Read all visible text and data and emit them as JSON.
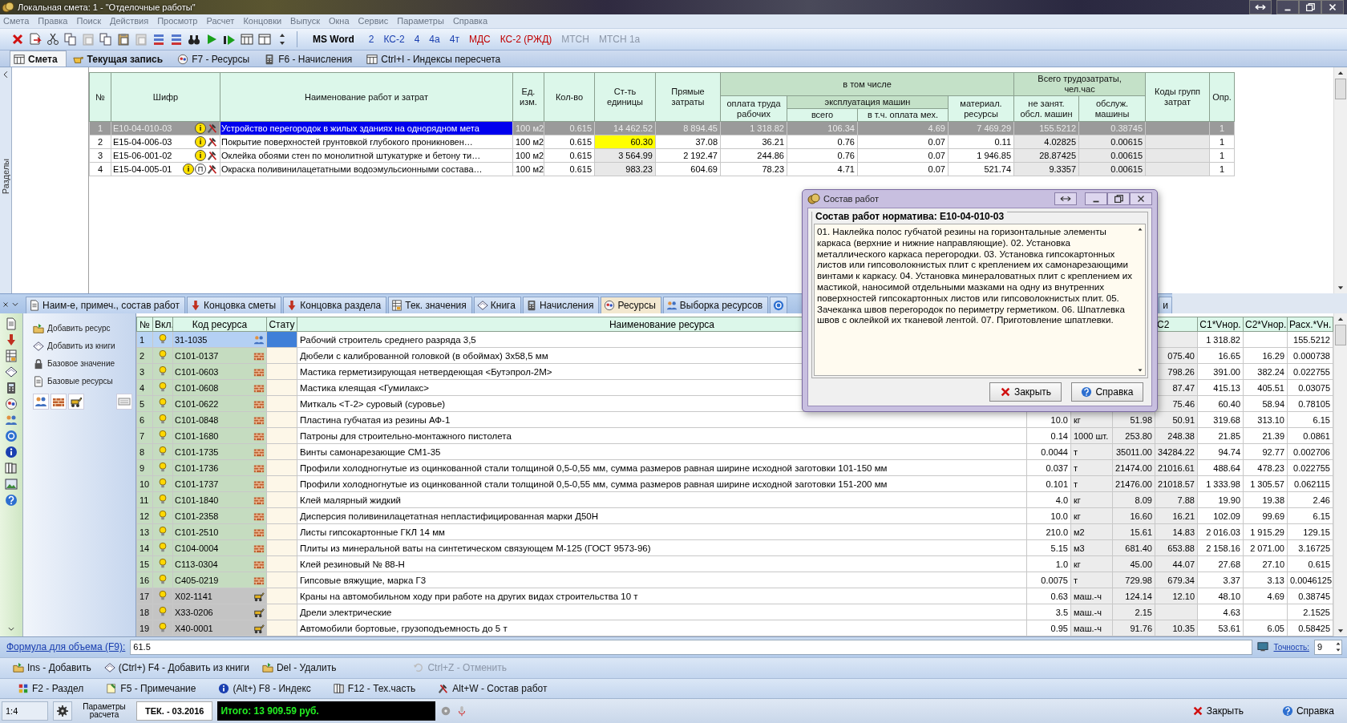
{
  "window": {
    "title": "Локальная смета: 1 - \"Отделочные работы\""
  },
  "menu": [
    "Смета",
    "Правка",
    "Поиск",
    "Действия",
    "Просмотр",
    "Расчет",
    "Концовки",
    "Выпуск",
    "Окна",
    "Сервис",
    "Параметры",
    "Справка"
  ],
  "toolbar_text_buttons": [
    {
      "label": "MS Word",
      "color": "#000000",
      "disabled": false,
      "bold": true
    },
    {
      "label": "2",
      "color": "#1a3fb0",
      "disabled": false,
      "bold": false
    },
    {
      "label": "КС-2",
      "color": "#1a3fb0",
      "disabled": false,
      "bold": false
    },
    {
      "label": "4",
      "color": "#1a3fb0",
      "disabled": false,
      "bold": false
    },
    {
      "label": "4а",
      "color": "#1a3fb0",
      "disabled": false,
      "bold": false
    },
    {
      "label": "4т",
      "color": "#1a3fb0",
      "disabled": false,
      "bold": false
    },
    {
      "label": "МДС",
      "color": "#c00000",
      "disabled": false,
      "bold": false
    },
    {
      "label": "КС-2 (РЖД)",
      "color": "#c00000",
      "disabled": false,
      "bold": false
    },
    {
      "label": "МТСН",
      "disabled": true,
      "bold": false
    },
    {
      "label": "МТСН 1а",
      "disabled": true,
      "bold": false
    }
  ],
  "main_tabs": [
    {
      "label": "Смета",
      "selected": true,
      "bold": true
    },
    {
      "label": "Текущая запись",
      "selected": false,
      "bold": true
    },
    {
      "label": "F7 - Ресурсы",
      "selected": false,
      "bold": false
    },
    {
      "label": "F6 - Начисления",
      "selected": false,
      "bold": false
    },
    {
      "label": "Ctrl+I - Индексы пересчета",
      "selected": false,
      "bold": false
    }
  ],
  "sections_panel": {
    "label": "Разделы"
  },
  "estimate_table": {
    "header_rows": [
      [
        {
          "text": "№",
          "rowspan": 3
        },
        {
          "text": "Шифр",
          "rowspan": 3
        },
        {
          "text": "Наименование работ и затрат",
          "rowspan": 3
        },
        {
          "text": "Ед.\nизм.",
          "rowspan": 3
        },
        {
          "text": "Кол-во",
          "rowspan": 3
        },
        {
          "text": "Ст-ть\nединицы",
          "rowspan": 3
        },
        {
          "text": "Прямые\nзатраты",
          "rowspan": 3
        },
        {
          "text": "в том числе",
          "colspan": 4,
          "group": true
        },
        {
          "text": "Всего трудозатраты,\nчел.час",
          "colspan": 2,
          "group": true
        },
        {
          "text": "Коды групп\nзатрат",
          "rowspan": 3
        },
        {
          "text": "Опр.",
          "rowspan": 3
        }
      ],
      [
        {
          "text": "оплата труда\nрабочих",
          "rowspan": 2
        },
        {
          "text": "эксплуатация машин",
          "colspan": 2,
          "group": true
        },
        {
          "text": "материал.\nресурсы",
          "rowspan": 2
        },
        {
          "text": "не занят.\nобсл. машин",
          "rowspan": 2
        },
        {
          "text": "обслуж.\nмашины",
          "rowspan": 2
        }
      ],
      [
        {
          "text": "всего"
        },
        {
          "text": "в т.ч. оплата мех."
        }
      ]
    ],
    "rows": [
      {
        "num": "1",
        "code": "E10-04-010-03",
        "badges": [
          {
            "text": "i",
            "kind": "info"
          }
        ],
        "name": "Устройство перегородок в жилых зданиях на однорядном мета",
        "unit": "100 м2",
        "qty": "0.615",
        "unit_cost": "14 462.52",
        "cost_highlight": false,
        "direct": "8 894.45",
        "labor": "1 318.82",
        "machines": "106.34",
        "machine_labor": "4.69",
        "materials": "7 469.29",
        "hours_labor": "155.5212",
        "hours_machine": "0.38745",
        "opr": "1",
        "selected": true
      },
      {
        "num": "2",
        "code": "E15-04-006-03",
        "badges": [
          {
            "text": "i",
            "kind": "info"
          }
        ],
        "name": "Покрытие поверхностей грунтовкой глубокого проникновен…",
        "unit": "100 м2",
        "qty": "0.615",
        "unit_cost": "60.30",
        "cost_highlight": true,
        "direct": "37.08",
        "labor": "36.21",
        "machines": "0.76",
        "machine_labor": "0.07",
        "materials": "0.11",
        "hours_labor": "4.02825",
        "hours_machine": "0.00615",
        "opr": "1",
        "selected": false
      },
      {
        "num": "3",
        "code": "E15-06-001-02",
        "badges": [
          {
            "text": "i",
            "kind": "info"
          }
        ],
        "name": "Оклейка обоями стен по монолитной штукатурке и бетону ти…",
        "unit": "100 м2",
        "qty": "0.615",
        "unit_cost": "3 564.99",
        "cost_highlight": false,
        "direct": "2 192.47",
        "labor": "244.86",
        "machines": "0.76",
        "machine_labor": "0.07",
        "materials": "1 946.85",
        "hours_labor": "28.87425",
        "hours_machine": "0.00615",
        "opr": "1",
        "selected": false
      },
      {
        "num": "4",
        "code": "E15-04-005-01",
        "badges": [
          {
            "text": "i",
            "kind": "info"
          },
          {
            "text": "П",
            "kind": "plain"
          }
        ],
        "name": "Окраска поливинилацетатными водоэмульсионными состава…",
        "unit": "100 м2",
        "qty": "0.615",
        "unit_cost": "983.23",
        "cost_highlight": false,
        "direct": "604.69",
        "labor": "78.23",
        "machines": "4.71",
        "machine_labor": "0.07",
        "materials": "521.74",
        "hours_labor": "9.3357",
        "hours_machine": "0.00615",
        "opr": "1",
        "selected": false
      }
    ]
  },
  "bottom_tabs": [
    {
      "label": "Наим-е, примеч., состав работ",
      "selected": false
    },
    {
      "label": "Концовка сметы",
      "selected": false
    },
    {
      "label": "Концовка раздела",
      "selected": false
    },
    {
      "label": "Тек. значения",
      "selected": false
    },
    {
      "label": "Книга",
      "selected": false
    },
    {
      "label": "Начисления",
      "selected": false
    },
    {
      "label": "Ресурсы",
      "selected": true
    },
    {
      "label": "Выборка ресурсов",
      "selected": false
    },
    {
      "label": "и",
      "selected": false,
      "kind": "cut"
    }
  ],
  "resource_actions": [
    "Добавить ресурс",
    "Добавить из книги",
    "Базовое значение",
    "Базовые ресурсы"
  ],
  "resource_table": {
    "columns": [
      {
        "label": "№"
      },
      {
        "label": "Вкл."
      },
      {
        "label": "Код ресурса"
      },
      {
        "label": "Стату"
      },
      {
        "label": "Наименование ресурса"
      },
      {},
      {},
      {},
      {
        "label": "C2"
      },
      {
        "label": "C1*Vнор."
      },
      {
        "label": "C2*Vнор."
      },
      {
        "label": "Расх.*Vн."
      }
    ],
    "rows": [
      {
        "num": "1",
        "kind": "labor",
        "included": true,
        "code": "31-1035",
        "name": "Рабочий строитель среднего разряда 3,5",
        "c1v": "1 318.82",
        "rate": "155.5212",
        "selected": true
      },
      {
        "num": "2",
        "kind": "material",
        "included": true,
        "code": "С101-0137",
        "name": "Дюбели с калиброванной головкой (в обоймах) 3х58,5 мм",
        "c2": "075.40",
        "c1v": "16.65",
        "c2v": "16.29",
        "rate": "0.000738",
        "selected": false
      },
      {
        "num": "3",
        "kind": "material",
        "included": true,
        "code": "С101-0603",
        "name": "Мастика герметизирующая нетвердеющая <Бутэпрол-2М>",
        "c2": "798.26",
        "c1v": "391.00",
        "c2v": "382.24",
        "rate": "0.022755",
        "selected": false
      },
      {
        "num": "4",
        "kind": "material",
        "included": true,
        "code": "С101-0608",
        "name": "Мастика клеящая <Гумилакс>",
        "c2": "87.47",
        "c1v": "415.13",
        "c2v": "405.51",
        "rate": "0.03075",
        "selected": false
      },
      {
        "num": "5",
        "kind": "material",
        "included": true,
        "code": "С101-0622",
        "name": "Миткаль <Т-2> суровый (суровье)",
        "c2": "75.46",
        "c1v": "60.40",
        "c2v": "58.94",
        "rate": "0.78105",
        "selected": false
      },
      {
        "num": "6",
        "kind": "material",
        "included": true,
        "code": "С101-0848",
        "name": "Пластина губчатая из резины АФ-1",
        "qty": "10.0",
        "unit": "кг",
        "c1": "51.98",
        "c2": "50.91",
        "c1v": "319.68",
        "c2v": "313.10",
        "rate": "6.15",
        "selected": false
      },
      {
        "num": "7",
        "kind": "material",
        "included": true,
        "code": "С101-1680",
        "name": "Патроны для строительно-монтажного пистолета",
        "qty": "0.14",
        "unit": "1000 шт.",
        "c1": "253.80",
        "c2": "248.38",
        "c1v": "21.85",
        "c2v": "21.39",
        "rate": "0.0861",
        "selected": false
      },
      {
        "num": "8",
        "kind": "material",
        "included": true,
        "code": "С101-1735",
        "name": "Винты самонарезающие СМ1-35",
        "qty": "0.0044",
        "unit": "т",
        "c1": "35011.00",
        "c2": "34284.22",
        "c1v": "94.74",
        "c2v": "92.77",
        "rate": "0.002706",
        "selected": false
      },
      {
        "num": "9",
        "kind": "material",
        "included": true,
        "code": "С101-1736",
        "name": "Профили холодногнутые из оцинкованной стали толщиной 0,5-0,55 мм, сумма размеров равная ширине исходной заготовки 101-150 мм",
        "qty": "0.037",
        "unit": "т",
        "c1": "21474.00",
        "c2": "21016.61",
        "c1v": "488.64",
        "c2v": "478.23",
        "rate": "0.022755",
        "selected": false
      },
      {
        "num": "10",
        "kind": "material",
        "included": true,
        "code": "С101-1737",
        "name": "Профили холодногнутые из оцинкованной стали толщиной 0,5-0,55 мм, сумма размеров равная ширине исходной заготовки 151-200 мм",
        "qty": "0.101",
        "unit": "т",
        "c1": "21476.00",
        "c2": "21018.57",
        "c1v": "1 333.98",
        "c2v": "1 305.57",
        "rate": "0.062115",
        "selected": false
      },
      {
        "num": "11",
        "kind": "material",
        "included": true,
        "code": "С101-1840",
        "name": "Клей малярный жидкий",
        "qty": "4.0",
        "unit": "кг",
        "c1": "8.09",
        "c2": "7.88",
        "c1v": "19.90",
        "c2v": "19.38",
        "rate": "2.46",
        "selected": false
      },
      {
        "num": "12",
        "kind": "material",
        "included": true,
        "code": "С101-2358",
        "name": "Дисперсия поливинилацетатная непластифицированная марки Д50Н",
        "qty": "10.0",
        "unit": "кг",
        "c1": "16.60",
        "c2": "16.21",
        "c1v": "102.09",
        "c2v": "99.69",
        "rate": "6.15",
        "selected": false
      },
      {
        "num": "13",
        "kind": "material",
        "included": true,
        "code": "С101-2510",
        "name": "Листы гипсокартонные ГКЛ 14 мм",
        "qty": "210.0",
        "unit": "м2",
        "c1": "15.61",
        "c2": "14.83",
        "c1v": "2 016.03",
        "c2v": "1 915.29",
        "rate": "129.15",
        "selected": false
      },
      {
        "num": "14",
        "kind": "material",
        "included": true,
        "code": "С104-0004",
        "name": "Плиты из минеральной ваты на синтетическом связующем М-125 (ГОСТ 9573-96)",
        "qty": "5.15",
        "unit": "м3",
        "c1": "681.40",
        "c2": "653.88",
        "c1v": "2 158.16",
        "c2v": "2 071.00",
        "rate": "3.16725",
        "selected": false
      },
      {
        "num": "15",
        "kind": "material",
        "included": true,
        "code": "С113-0304",
        "name": "Клей резиновый № 88-Н",
        "qty": "1.0",
        "unit": "кг",
        "c1": "45.00",
        "c2": "44.07",
        "c1v": "27.68",
        "c2v": "27.10",
        "rate": "0.615",
        "selected": false
      },
      {
        "num": "16",
        "kind": "material",
        "included": true,
        "code": "С405-0219",
        "name": "Гипсовые вяжущие, марка Г3",
        "qty": "0.0075",
        "unit": "т",
        "c1": "729.98",
        "c2": "679.34",
        "c1v": "3.37",
        "c2v": "3.13",
        "rate": "0.0046125",
        "selected": false
      },
      {
        "num": "17",
        "kind": "machine",
        "included": true,
        "code": "Х02-1141",
        "name": "Краны на автомобильном ходу при работе на других видах строительства 10 т",
        "qty": "0.63",
        "unit": "маш.-ч",
        "c1": "124.14",
        "c2": "12.10",
        "c1v": "48.10",
        "c2v": "4.69",
        "rate": "0.38745",
        "selected": false
      },
      {
        "num": "18",
        "kind": "machine",
        "included": true,
        "code": "Х33-0206",
        "name": "Дрели электрические",
        "qty": "3.5",
        "unit": "маш.-ч",
        "c1": "2.15",
        "c1v": "4.63",
        "rate": "2.1525",
        "selected": false
      },
      {
        "num": "19",
        "kind": "machine",
        "included": true,
        "code": "Х40-0001",
        "name": "Автомобили бортовые, грузоподъемность до 5 т",
        "qty": "0.95",
        "unit": "маш.-ч",
        "c1": "91.76",
        "c2": "10.35",
        "c1v": "53.61",
        "c2v": "6.05",
        "rate": "0.58425",
        "selected": false
      }
    ]
  },
  "dialog": {
    "title": "Состав работ",
    "group_title": "Состав работ норматива: E10-04-010-03",
    "text": "01. Наклейка полос губчатой резины на горизонтальные элементы каркаса (верхние и нижние направляющие). 02. Установка металлического каркаса перегородки. 03. Установка гипсокартонных листов или гипсоволокнистых плит с креплением их самонарезающими винтами к каркасу. 04. Установка минераловатных плит с креплением их мастикой, наносимой отдельными мазками на одну из внутренних поверхностей гипсокартонных листов или гипсоволокнистых плит. 05. Зачеканка швов перегородок по периметру герметиком. 06. Шпатлевка швов с оклейкой их тканевой лентой. 07. Приготовление шпатлевки.",
    "buttons": [
      "Закрыть",
      "Справка"
    ]
  },
  "formula_bar": {
    "label": "Формула для объема (F9):",
    "value": "61.5",
    "precision_label": "Точность:",
    "precision": "9"
  },
  "action_bar": [
    {
      "label": "Ins - Добавить",
      "disabled": false
    },
    {
      "label": "(Ctrl+) F4 - Добавить из книги",
      "disabled": false
    },
    {
      "label": "Del - Удалить",
      "disabled": false
    },
    {
      "label": "Ctrl+Z - Отменить",
      "disabled": true
    }
  ],
  "shortcut_bar": [
    "F2 - Раздел",
    "F5 - Примечание",
    "(Alt+) F8 - Индекс",
    "F12 - Тех.часть",
    "Alt+W - Состав работ"
  ],
  "status_bar": {
    "position": "1:4",
    "params": "Параметры\nрасчета",
    "period": "ТЕК. - 03.2016",
    "total": "Итого: 13 909.59 руб.",
    "buttons": [
      "Закрыть",
      "Справка"
    ]
  }
}
